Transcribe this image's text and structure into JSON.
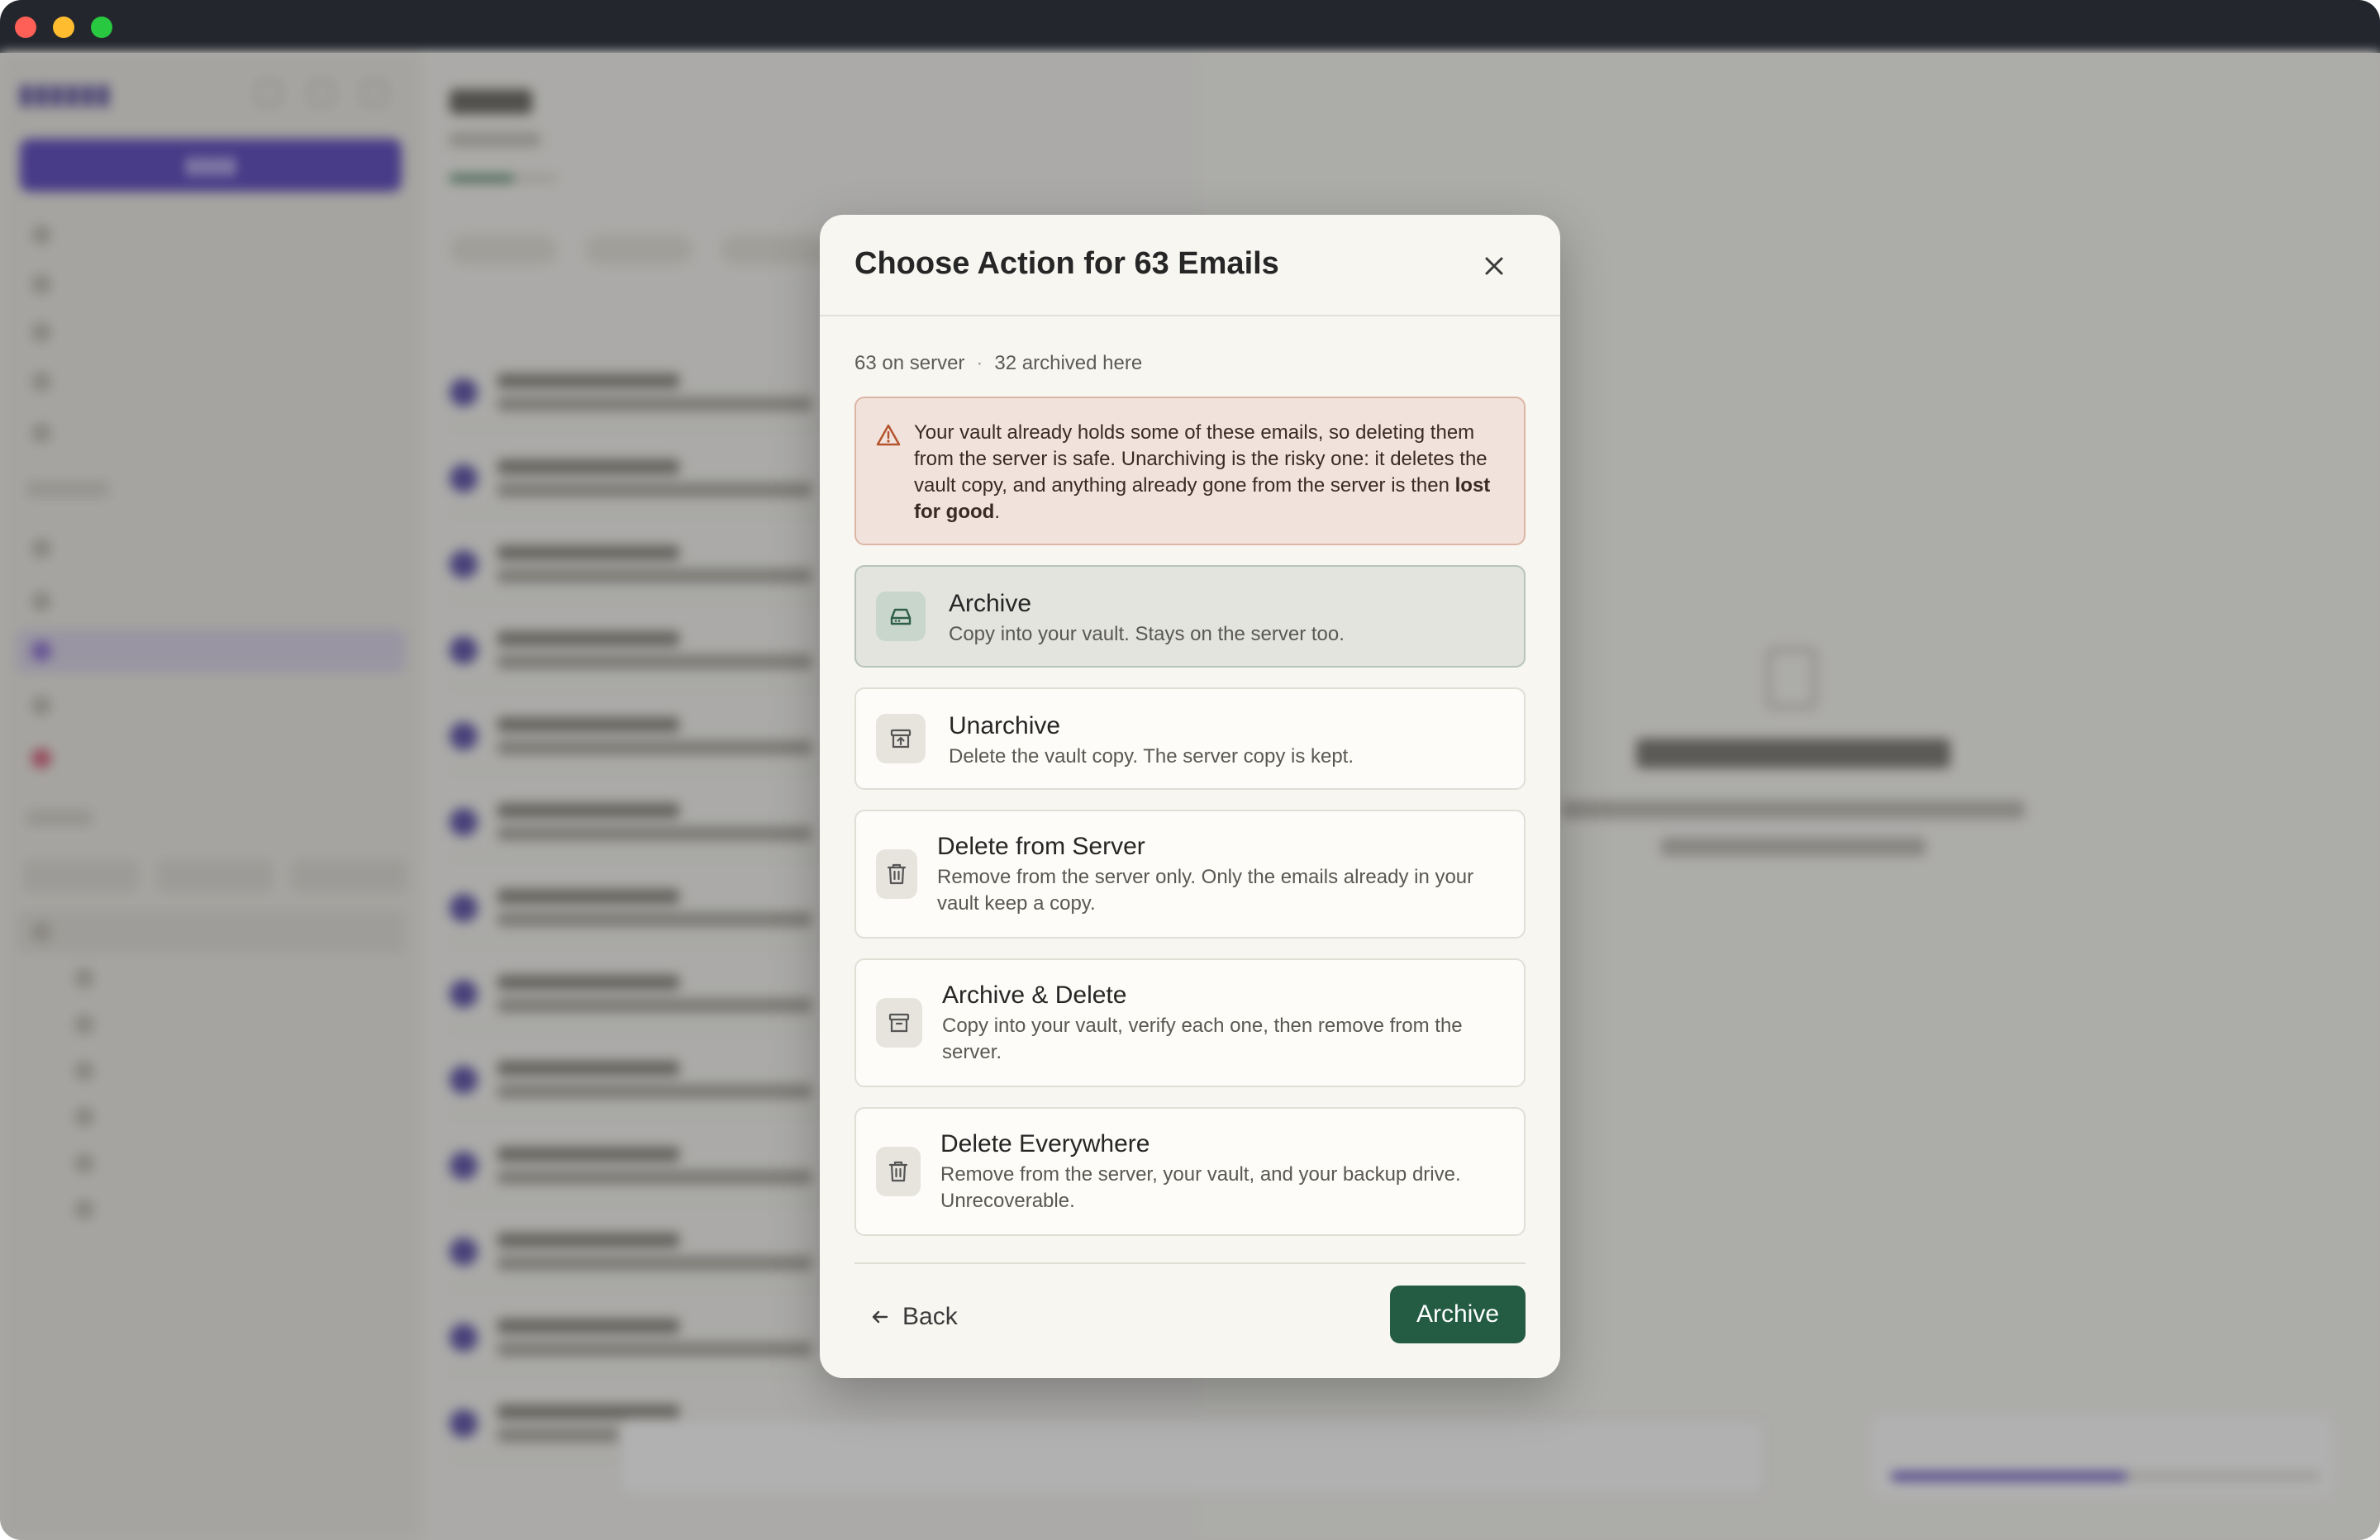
{
  "window": {
    "traffic_lights": [
      "close",
      "minimize",
      "zoom"
    ]
  },
  "modal": {
    "title": "Choose Action for 63 Emails",
    "meta": {
      "server_count": "63 on server",
      "separator": "·",
      "archived_count": "32 archived here"
    },
    "warning": {
      "text_before": "Your vault already holds some of these emails, so deleting them from the server is safe. Unarchiving is the risky one: it deletes the vault copy, and anything already gone from the server is then ",
      "text_bold": "lost for good",
      "text_after": ".",
      "icon": "warning-triangle-icon",
      "color": "#b5542e"
    },
    "options": [
      {
        "title": "Archive",
        "description": "Copy into your vault. Stays on the server too.",
        "icon": "drive-icon",
        "selected": true
      },
      {
        "title": "Unarchive",
        "description": "Delete the vault copy. The server copy is kept.",
        "icon": "unarchive-icon",
        "selected": false
      },
      {
        "title": "Delete from Server",
        "description": "Remove from the server only. Only the emails already in your vault keep a copy.",
        "icon": "trash-icon",
        "selected": false
      },
      {
        "title": "Archive & Delete",
        "description": "Copy into your vault, verify each one, then remove from the server.",
        "icon": "archive-box-icon",
        "selected": false
      },
      {
        "title": "Delete Everywhere",
        "description": "Remove from the server, your vault, and your backup drive. Unrecoverable.",
        "icon": "trash-icon",
        "selected": false
      }
    ],
    "footer": {
      "back_label": "Back",
      "primary_label": "Archive"
    }
  },
  "colors": {
    "accent": "#235b43",
    "brand": "#4a34b8",
    "warning_bg": "#f1e3dc"
  }
}
